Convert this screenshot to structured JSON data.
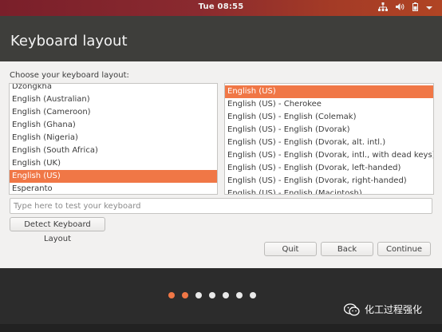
{
  "topbar": {
    "clock": "Tue 08:55"
  },
  "header": {
    "title": "Keyboard layout"
  },
  "prompt": "Choose your keyboard layout:",
  "layouts": [
    "Dzongkha",
    "English (Australian)",
    "English (Cameroon)",
    "English (Ghana)",
    "English (Nigeria)",
    "English (South Africa)",
    "English (UK)",
    "English (US)",
    "Esperanto"
  ],
  "layouts_selected": "English (US)",
  "variants": [
    "English (US)",
    "English (US) - Cherokee",
    "English (US) - English (Colemak)",
    "English (US) - English (Dvorak)",
    "English (US) - English (Dvorak, alt. intl.)",
    "English (US) - English (Dvorak, intl., with dead keys)",
    "English (US) - English (Dvorak, left-handed)",
    "English (US) - English (Dvorak, right-handed)",
    "English (US) - English (Macintosh)"
  ],
  "variants_selected": "English (US)",
  "test_input": {
    "placeholder": "Type here to test your keyboard",
    "value": ""
  },
  "buttons": {
    "detect": "Detect Keyboard Layout",
    "quit": "Quit",
    "back": "Back",
    "continue": "Continue"
  },
  "progress": {
    "total_steps": 7,
    "current_step": 2
  },
  "watermark": "化工过程强化",
  "colors": {
    "accent": "#f07746",
    "header_bg": "#3e3e3b",
    "content_bg": "#f2f1f0"
  }
}
